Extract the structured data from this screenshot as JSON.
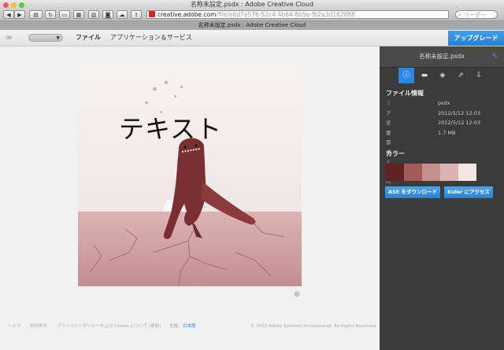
{
  "window": {
    "title": "名称未設定.psdx : Adobe Creative Cloud"
  },
  "browser": {
    "url_domain": "creative.adobe.com",
    "url_path": "/file/e6d7e576-52c4-4b64-8b5e-fb2a3d162888",
    "search_placeholder": "リーダー",
    "tab_title": "名称未設定.psdx : Adobe Creative Cloud",
    "icons": [
      "back-icon",
      "forward-icon",
      "sidebar-icon",
      "reload-icon",
      "print-icon",
      "bookmarks-icon",
      "reader-icon",
      "share-icon",
      "cloud-icon",
      "send-icon"
    ]
  },
  "app": {
    "nav": {
      "files": "ファイル",
      "apps_services": "アプリケーション＆サービス"
    },
    "upgrade_label": "アップグレード"
  },
  "artwork": {
    "text": "テキスト"
  },
  "footer": {
    "help": "ヘルプ",
    "terms": "利用条件",
    "privacy": "プライバシーポリシーおよび Cookie について (更新)",
    "language_label": "言語:",
    "language_value": "日本語",
    "copyright": "© 2012 Adobe Systems Incorporated. All Rights Reserved."
  },
  "panel": {
    "file_name": "名称未設定.psdx",
    "file_info_title": "ファイル情報",
    "info": [
      {
        "key": "ファイル形式",
        "value": "psdx"
      },
      {
        "key": "アップロード日時",
        "value": "2012/5/12 12:03"
      },
      {
        "key": "変更日時",
        "value": "2012/5/12 12:03"
      },
      {
        "key": "サイズ",
        "value": "1.7 MB"
      }
    ],
    "colors_title": "カラー",
    "swatches": [
      "#5e2427",
      "#a25a5b",
      "#c38f91",
      "#dcb3b4",
      "#f3e5e6"
    ],
    "ase_button": "ASE をダウンロード",
    "kuler_button": "Kuler にアクセス"
  },
  "colors": {
    "accent": "#2e86de",
    "panel_bg": "#3b3b3b"
  }
}
